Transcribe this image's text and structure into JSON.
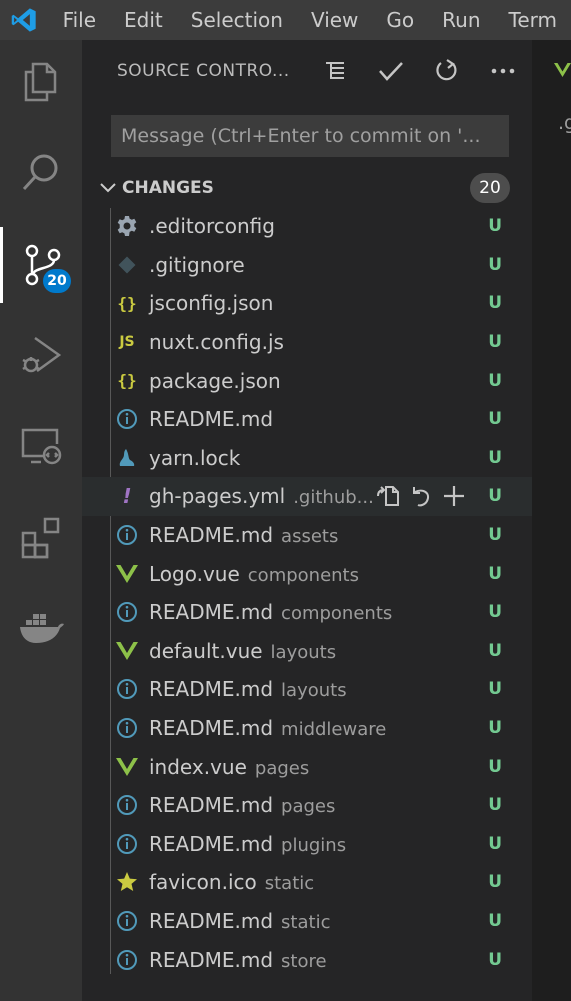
{
  "menu": [
    "File",
    "Edit",
    "Selection",
    "View",
    "Go",
    "Run",
    "Term"
  ],
  "activity": {
    "scm_badge": "20"
  },
  "scm": {
    "title": "SOURCE CONTRO...",
    "message_placeholder": "Message (Ctrl+Enter to commit on '...",
    "changes_label": "CHANGES",
    "changes_count": "20"
  },
  "files": [
    {
      "name": ".editorconfig",
      "dir": "",
      "status": "U",
      "icon": "gear-icon",
      "color": "#9aa5b1"
    },
    {
      "name": ".gitignore",
      "dir": "",
      "status": "U",
      "icon": "git-icon",
      "color": "#41535b"
    },
    {
      "name": "jsconfig.json",
      "dir": "",
      "status": "U",
      "icon": "json-icon",
      "color": "#cbcb41"
    },
    {
      "name": "nuxt.config.js",
      "dir": "",
      "status": "U",
      "icon": "js-icon",
      "color": "#cbcb41"
    },
    {
      "name": "package.json",
      "dir": "",
      "status": "U",
      "icon": "json-icon",
      "color": "#cbcb41"
    },
    {
      "name": "README.md",
      "dir": "",
      "status": "U",
      "icon": "info-icon",
      "color": "#519aba"
    },
    {
      "name": "yarn.lock",
      "dir": "",
      "status": "U",
      "icon": "yarn-icon",
      "color": "#519aba"
    },
    {
      "name": "gh-pages.yml",
      "dir": ".github...",
      "status": "U",
      "icon": "yaml-icon",
      "color": "#a074c4"
    },
    {
      "name": "README.md",
      "dir": "assets",
      "status": "U",
      "icon": "info-icon",
      "color": "#519aba"
    },
    {
      "name": "Logo.vue",
      "dir": "components",
      "status": "U",
      "icon": "vue-icon",
      "color": "#8dc149"
    },
    {
      "name": "README.md",
      "dir": "components",
      "status": "U",
      "icon": "info-icon",
      "color": "#519aba"
    },
    {
      "name": "default.vue",
      "dir": "layouts",
      "status": "U",
      "icon": "vue-icon",
      "color": "#8dc149"
    },
    {
      "name": "README.md",
      "dir": "layouts",
      "status": "U",
      "icon": "info-icon",
      "color": "#519aba"
    },
    {
      "name": "README.md",
      "dir": "middleware",
      "status": "U",
      "icon": "info-icon",
      "color": "#519aba"
    },
    {
      "name": "index.vue",
      "dir": "pages",
      "status": "U",
      "icon": "vue-icon",
      "color": "#8dc149"
    },
    {
      "name": "README.md",
      "dir": "pages",
      "status": "U",
      "icon": "info-icon",
      "color": "#519aba"
    },
    {
      "name": "README.md",
      "dir": "plugins",
      "status": "U",
      "icon": "info-icon",
      "color": "#519aba"
    },
    {
      "name": "favicon.ico",
      "dir": "static",
      "status": "U",
      "icon": "star-icon",
      "color": "#cbcb41"
    },
    {
      "name": "README.md",
      "dir": "static",
      "status": "U",
      "icon": "info-icon",
      "color": "#519aba"
    },
    {
      "name": "README.md",
      "dir": "store",
      "status": "U",
      "icon": "info-icon",
      "color": "#519aba"
    }
  ],
  "editor": {
    "partial_text": ".g"
  },
  "colors": {
    "accent": "#007acc",
    "untracked": "#73c991"
  }
}
